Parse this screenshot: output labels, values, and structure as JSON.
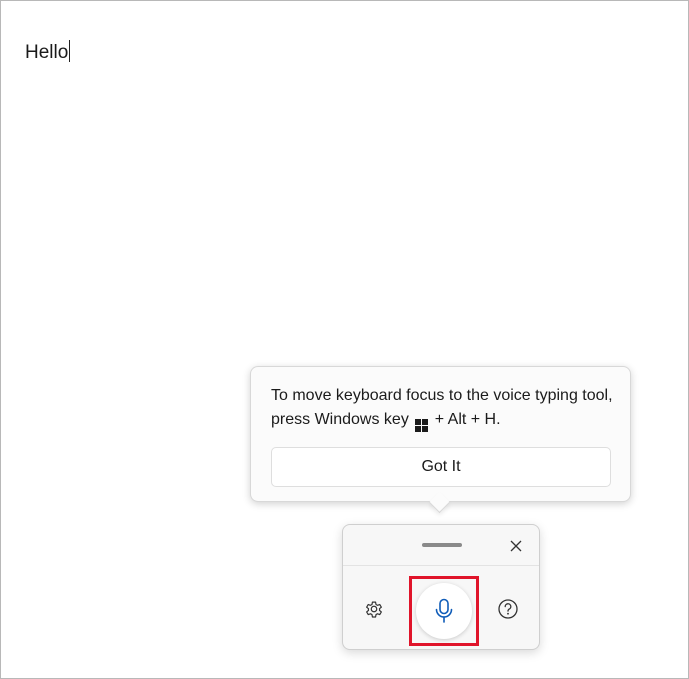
{
  "document": {
    "text": "Hello"
  },
  "teaching_tip": {
    "message_part1": "To move keyboard focus to the voice typing tool, press Windows key",
    "message_part2": "+ Alt + H.",
    "button_label": "Got It"
  },
  "voice_panel": {
    "icons": {
      "drag": "drag-handle",
      "close": "close-icon",
      "settings": "gear-icon",
      "microphone": "microphone-icon",
      "help": "help-icon"
    },
    "colors": {
      "mic": "#0f5cb8",
      "highlight": "#e0142a"
    }
  }
}
